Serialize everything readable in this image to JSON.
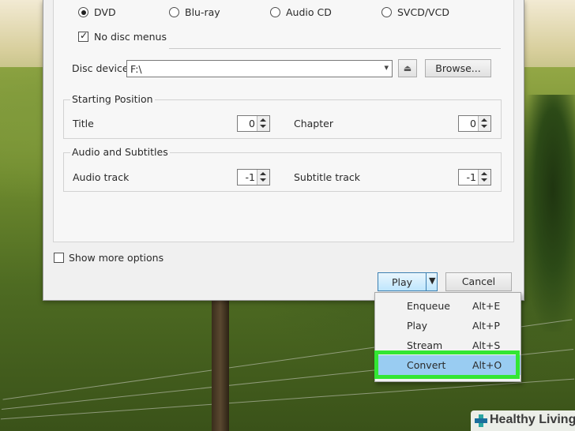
{
  "disc_types": [
    {
      "label": "DVD",
      "checked": true
    },
    {
      "label": "Blu-ray",
      "checked": false
    },
    {
      "label": "Audio CD",
      "checked": false
    },
    {
      "label": "SVCD/VCD",
      "checked": false
    }
  ],
  "no_disc_menus": {
    "label": "No disc menus",
    "checked": true
  },
  "disc_device": {
    "label": "Disc device",
    "value": "F:\\",
    "browse_label": "Browse..."
  },
  "starting_position": {
    "title": "Starting Position",
    "title_label": "Title",
    "title_value": "0",
    "chapter_label": "Chapter",
    "chapter_value": "0"
  },
  "audio_subtitles": {
    "title": "Audio and Subtitles",
    "audio_label": "Audio track",
    "audio_value": "-1",
    "subtitle_label": "Subtitle track",
    "subtitle_value": "-1"
  },
  "show_more_options": {
    "label": "Show more options",
    "checked": false
  },
  "buttons": {
    "play": "Play",
    "cancel": "Cancel"
  },
  "play_menu": [
    {
      "label": "Enqueue",
      "shortcut": "Alt+E",
      "selected": false
    },
    {
      "label": "Play",
      "shortcut": "Alt+P",
      "selected": false
    },
    {
      "label": "Stream",
      "shortcut": "Alt+S",
      "selected": false
    },
    {
      "label": "Convert",
      "shortcut": "Alt+O",
      "selected": true
    }
  ],
  "colors": {
    "highlight_box": "#33e633",
    "menu_selection": "#99ccf2"
  },
  "watermark": {
    "text": "Healthy Living"
  }
}
